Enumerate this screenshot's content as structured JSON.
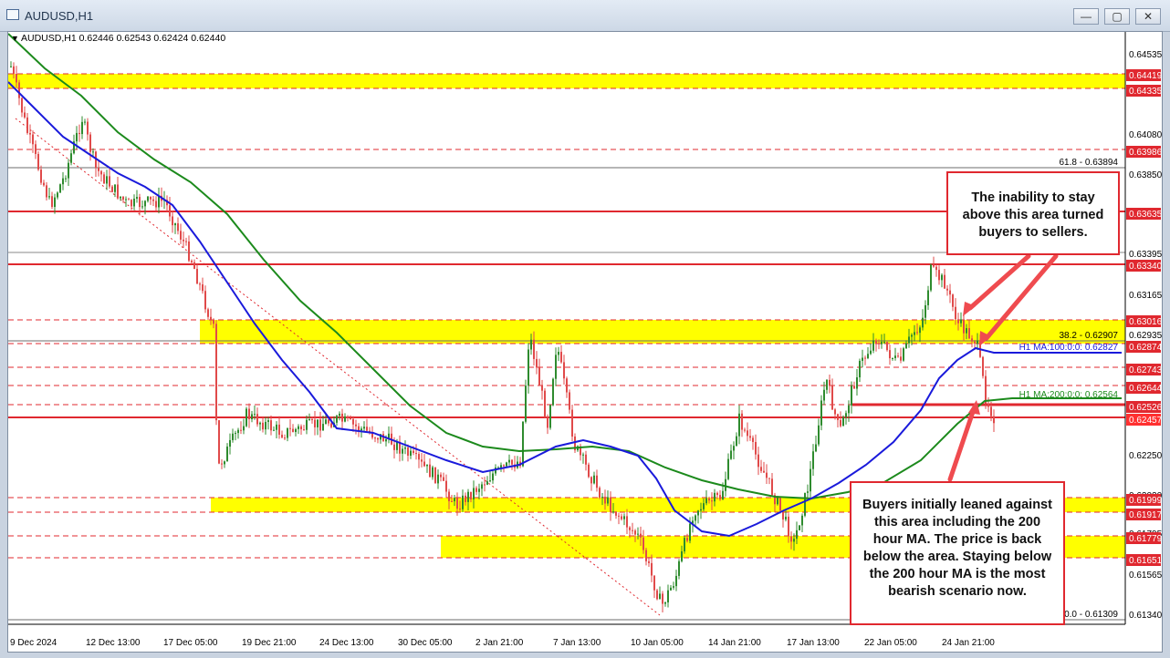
{
  "window": {
    "title": "AUDUSD,H1",
    "min_symbol": "—",
    "max_symbol": "▢",
    "close_symbol": "✕"
  },
  "chart": {
    "header": "AUDUSD,H1  0.62446 0.62543 0.62424 0.62440",
    "colors": {
      "background": "#ffffff",
      "zone": "#ffff00",
      "resistance_line": "#e0282f",
      "ma100": "#1a1adb",
      "ma200": "#1c8a1c",
      "bull_candle": "#2e8b2e",
      "bear_candle": "#e04a4a",
      "level_label_bg": "#e0282f",
      "current_price_bg": "#ff3030"
    },
    "price_axis_ticks": [
      "0.64535",
      "0.64080",
      "0.63850",
      "0.63395",
      "0.63165",
      "0.62935",
      "0.62250",
      "0.62020",
      "0.61795",
      "0.61565",
      "0.61340"
    ],
    "price_labels": [
      "0.64419",
      "0.64335",
      "0.63986",
      "0.63635",
      "0.63340",
      "0.63016",
      "0.62874",
      "0.62743",
      "0.62644",
      "0.62526",
      "0.62457",
      "0.61999",
      "0.61917",
      "0.61779",
      "0.61651"
    ],
    "time_axis_labels": [
      "9 Dec 2024",
      "12 Dec 13:00",
      "17 Dec 05:00",
      "19 Dec 21:00",
      "24 Dec 13:00",
      "30 Dec 05:00",
      "2 Jan 21:00",
      "7 Jan 13:00",
      "10 Jan 05:00",
      "14 Jan 21:00",
      "17 Jan 13:00",
      "22 Jan 05:00",
      "24 Jan 21:00"
    ],
    "fib_labels": {
      "f618": "61.8 - 0.63894",
      "f382": "38.2 - 0.62907",
      "f0": "0.0 - 0.61309"
    },
    "ma_labels": {
      "ma100": "H1 MA:100:0:0: 0.62827",
      "ma200": "H1 MA:200:0:0: 0.62564"
    }
  },
  "annotations": {
    "top_callout": "The inability to stay above this area turned buyers to sellers.",
    "bottom_callout": "Buyers initially leaned against this area including the 200 hour MA.  The price is back below the area.  Staying below the 200 hour MA is the most bearish scenario now."
  }
}
